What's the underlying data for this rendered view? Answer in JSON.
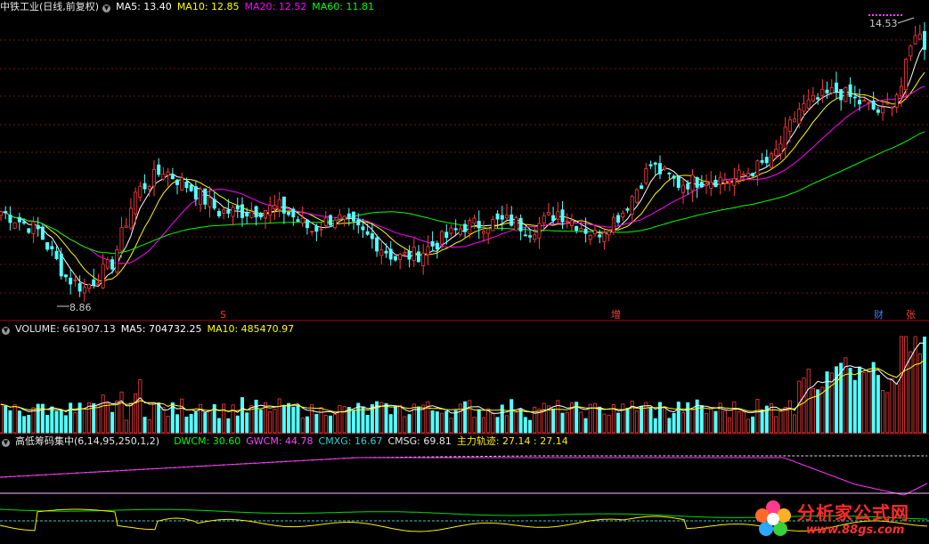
{
  "price_header": {
    "title": "中铁工业(日线,前复权)",
    "ma5": "MA5: 13.40",
    "ma10": "MA10: 12.85",
    "ma20": "MA20: 12.52",
    "ma60": "MA60: 11.81"
  },
  "volume_header": {
    "title": "VOLUME: 661907.13",
    "ma5": "MA5: 704732.25",
    "ma10": "MA10: 485470.97"
  },
  "indicator_header": {
    "title": "高低筹码集中(6,14,95,250,1,2)",
    "dwcm": "DWCM: 30.60",
    "gwcm": "GWCM: 44.78",
    "cmxg": "CMXG: 16.67",
    "cmsg": "CMSG: 69.81",
    "zljj": "主力轨迹: 27.14 : 27.14"
  },
  "annotations": {
    "high_label": "14.53",
    "low_label": "8.86",
    "marker_s": "S",
    "marker_zeng": "增",
    "marker_cai": "财",
    "marker_zhang": "张"
  },
  "watermark": {
    "line1": "分析家公式网",
    "line2": "www.88gs.com"
  },
  "colors": {
    "up": "#ff3b3b",
    "down": "#54ffff",
    "ma5": "#ffffff",
    "ma10": "#ffff00",
    "ma20": "#ff00ff",
    "ma60": "#00ff00",
    "grid": "#7a1010",
    "separator": "#a01010"
  },
  "chart_data": [
    {
      "type": "candlestick",
      "title": "中铁工业(日线,前复权)",
      "ylim": [
        8.3,
        14.8
      ],
      "high": 14.53,
      "low": 8.86,
      "series": [
        {
          "name": "MA5",
          "last": 13.4
        },
        {
          "name": "MA10",
          "last": 12.85
        },
        {
          "name": "MA20",
          "last": 12.52
        },
        {
          "name": "MA60",
          "last": 11.81
        }
      ]
    },
    {
      "type": "bar",
      "title": "VOLUME",
      "last_volume": 661907.13,
      "series": [
        {
          "name": "MA5",
          "last": 704732.25
        },
        {
          "name": "MA10",
          "last": 485470.97
        }
      ]
    },
    {
      "type": "line",
      "title": "高低筹码集中(6,14,95,250,1,2)",
      "series": [
        {
          "name": "DWCM",
          "last": 30.6
        },
        {
          "name": "GWCM",
          "last": 44.78
        },
        {
          "name": "CMXG",
          "last": 16.67
        },
        {
          "name": "CMSG",
          "last": 69.81
        },
        {
          "name": "主力轨迹",
          "last": 27.14
        }
      ]
    }
  ]
}
